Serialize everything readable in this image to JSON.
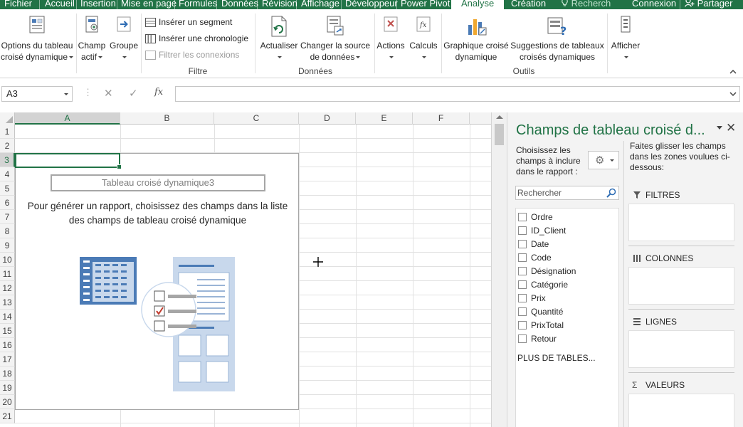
{
  "tabs": [
    {
      "label": "Fichier",
      "state": "normal"
    },
    {
      "label": "Accueil",
      "state": "normal"
    },
    {
      "label": "Insertion",
      "state": "normal"
    },
    {
      "label": "Mise en page",
      "state": "normal"
    },
    {
      "label": "Formules",
      "state": "normal"
    },
    {
      "label": "Données",
      "state": "normal"
    },
    {
      "label": "Révision",
      "state": "normal"
    },
    {
      "label": "Affichage",
      "state": "normal"
    },
    {
      "label": "Développeur",
      "state": "normal"
    },
    {
      "label": "Power Pivot",
      "state": "normal"
    },
    {
      "label": "Analyse",
      "state": "active"
    },
    {
      "label": "Création",
      "state": "normal"
    },
    {
      "label": "Recherch",
      "state": "dim"
    },
    {
      "label": "Connexion",
      "state": "normal"
    },
    {
      "label": "Partager",
      "state": "normal"
    }
  ],
  "ribbon": {
    "options_l1": "Options du tableau",
    "options_l2": "croisé dynamique",
    "champ_l1": "Champ",
    "champ_l2": "actif",
    "groupe": "Groupe",
    "insert_segment": "Insérer un segment",
    "insert_chrono": "Insérer une chronologie",
    "filter_conn": "Filtrer les connexions",
    "group_filtre": "Filtre",
    "actualiser": "Actualiser",
    "change_l1": "Changer la source",
    "change_l2": "de données",
    "group_donnees": "Données",
    "actions": "Actions",
    "calculs": "Calculs",
    "graph_l1": "Graphique croisé",
    "graph_l2": "dynamique",
    "sugg_l1": "Suggestions de tableaux",
    "sugg_l2": "croisés dynamiques",
    "group_outils": "Outils",
    "afficher": "Afficher"
  },
  "formula_bar": {
    "name_box": "A3",
    "cancel_icon": "x-icon",
    "enter_icon": "check-icon",
    "fx": "fx",
    "value": ""
  },
  "grid": {
    "columns": [
      "A",
      "B",
      "C",
      "D",
      "E",
      "F"
    ],
    "rows": [
      "1",
      "2",
      "3",
      "4",
      "5",
      "6",
      "7",
      "8",
      "9",
      "10",
      "11",
      "12",
      "13",
      "14",
      "15",
      "16",
      "17",
      "18",
      "19",
      "20",
      "21"
    ],
    "selected_cell": "A3"
  },
  "pivot": {
    "title": "Tableau croisé dynamique3",
    "message": "Pour générer un rapport, choisissez des champs dans la liste des champs de tableau croisé dynamique"
  },
  "pane": {
    "title": "Champs de tableau croisé d...",
    "choose": "Choisissez les champs à inclure dans le rapport :",
    "search_placeholder": "Rechercher",
    "fields": [
      "Ordre",
      "ID_Client",
      "Date",
      "Code",
      "Désignation",
      "Catégorie",
      "Prix",
      "Quantité",
      "PrixTotal",
      "Retour"
    ],
    "more_tables": "PLUS DE TABLES...",
    "drag_text": "Faites glisser les champs dans les zones voulues ci-dessous:",
    "zones": {
      "filtres": "FILTRES",
      "colonnes": "COLONNES",
      "lignes": "LIGNES",
      "valeurs": "VALEURS"
    }
  },
  "colors": {
    "accent": "#217346",
    "header_bg": "#f3f3f3",
    "grid_line": "#e1e1e1",
    "art_blue": "#4b7bb6",
    "art_light": "#c8d8ec"
  }
}
